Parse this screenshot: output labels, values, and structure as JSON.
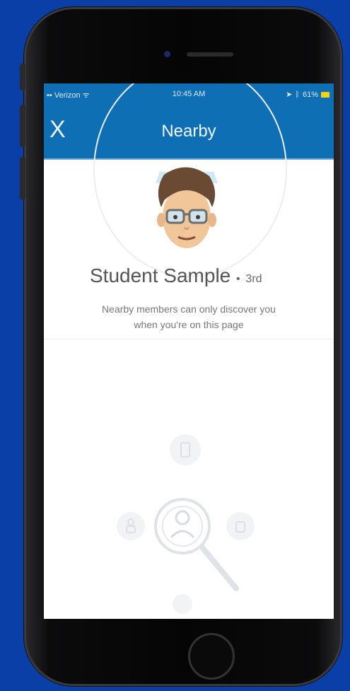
{
  "status_bar": {
    "carrier": "Verizon",
    "time": "10:45 AM",
    "battery_percent": "61%"
  },
  "header": {
    "close_label": "X",
    "title": "Nearby"
  },
  "profile": {
    "name": "Student Sample",
    "degree": "3rd"
  },
  "info": {
    "line1": "Nearby members can only discover you",
    "line2": "when you're on this page"
  },
  "colors": {
    "brand_blue": "#0e6fb5",
    "background_blue": "#0a3fa8"
  },
  "icons": [
    "signal-icon",
    "wifi-icon",
    "location-icon",
    "bluetooth-icon",
    "battery-icon",
    "close-icon",
    "avatar-illustration",
    "magnifier-person-icon"
  ]
}
